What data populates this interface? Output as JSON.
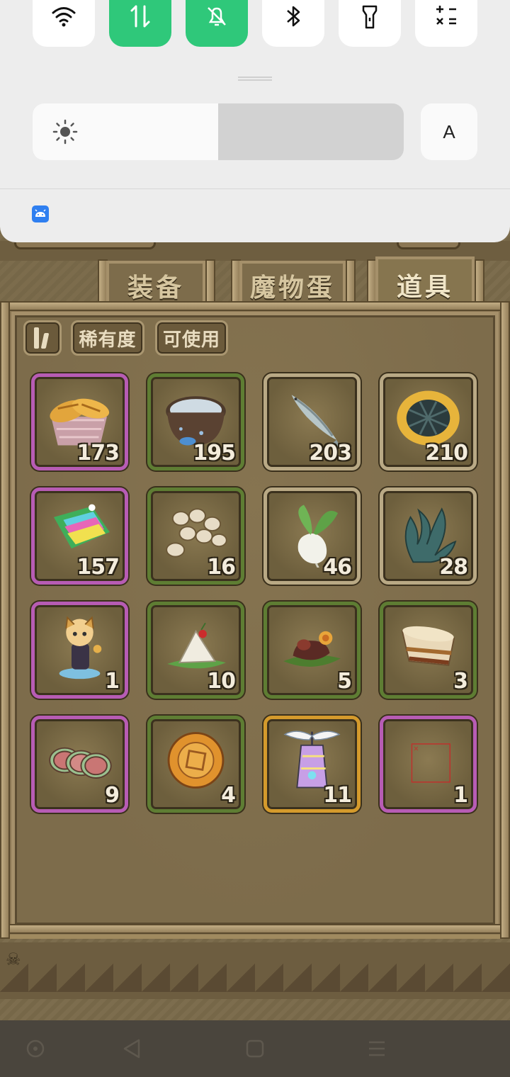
{
  "quick_settings": {
    "tiles": [
      {
        "name": "wifi",
        "icon": "wifi-icon",
        "active": false
      },
      {
        "name": "mobile-data",
        "icon": "data-transfer-icon",
        "active": true
      },
      {
        "name": "silent",
        "icon": "bell-off-icon",
        "active": true
      },
      {
        "name": "bluetooth",
        "icon": "bluetooth-icon",
        "active": false
      },
      {
        "name": "flashlight",
        "icon": "flashlight-icon",
        "active": false
      },
      {
        "name": "calculator",
        "icon": "calculator-icon",
        "active": false
      }
    ],
    "brightness_level": 0.5,
    "auto_brightness_label": "A",
    "notification_app_icon": "android-robot-icon",
    "colors": {
      "active": "#2fc87a",
      "panel": "#ededed"
    }
  },
  "game": {
    "tabs": [
      {
        "label": "装备",
        "active": false
      },
      {
        "label": "魔物蛋",
        "active": false
      },
      {
        "label": "道具",
        "active": true
      }
    ],
    "filters": {
      "sort_icon": "sort-toggle-icon",
      "rarity_label": "稀有度",
      "usable_label": "可使用"
    },
    "rarity_colors": {
      "purple": "#b75cb4",
      "green": "#5e7d33",
      "beige": "#b9a985",
      "gold": "#d49a2c"
    },
    "items": [
      {
        "icon": "bread-basket-icon",
        "count": "173",
        "rarity": "purple"
      },
      {
        "icon": "water-bowl-icon",
        "count": "195",
        "rarity": "green"
      },
      {
        "icon": "fish-icon",
        "count": "203",
        "rarity": "beige"
      },
      {
        "icon": "pie-icon",
        "count": "210",
        "rarity": "beige"
      },
      {
        "icon": "rainbow-cake-icon",
        "count": "157",
        "rarity": "purple"
      },
      {
        "icon": "beans-icon",
        "count": "16",
        "rarity": "green"
      },
      {
        "icon": "radish-icon",
        "count": "46",
        "rarity": "beige"
      },
      {
        "icon": "seaweed-icon",
        "count": "28",
        "rarity": "beige"
      },
      {
        "icon": "character-figure-icon",
        "count": "1",
        "rarity": "purple"
      },
      {
        "icon": "rice-ball-icon",
        "count": "10",
        "rarity": "green"
      },
      {
        "icon": "roast-meat-icon",
        "count": "5",
        "rarity": "green"
      },
      {
        "icon": "pudding-icon",
        "count": "3",
        "rarity": "green"
      },
      {
        "icon": "ham-slices-icon",
        "count": "9",
        "rarity": "purple"
      },
      {
        "icon": "mooncake-icon",
        "count": "4",
        "rarity": "green"
      },
      {
        "icon": "winged-lantern-icon",
        "count": "11",
        "rarity": "gold"
      },
      {
        "icon": "missing-image-icon",
        "count": "1",
        "rarity": "purple"
      }
    ]
  },
  "navbar": {
    "buttons": [
      {
        "name": "assist",
        "icon": "circle-dot-icon"
      },
      {
        "name": "back",
        "icon": "back-triangle-icon"
      },
      {
        "name": "home",
        "icon": "home-square-icon"
      },
      {
        "name": "recents",
        "icon": "menu-lines-icon"
      }
    ]
  }
}
